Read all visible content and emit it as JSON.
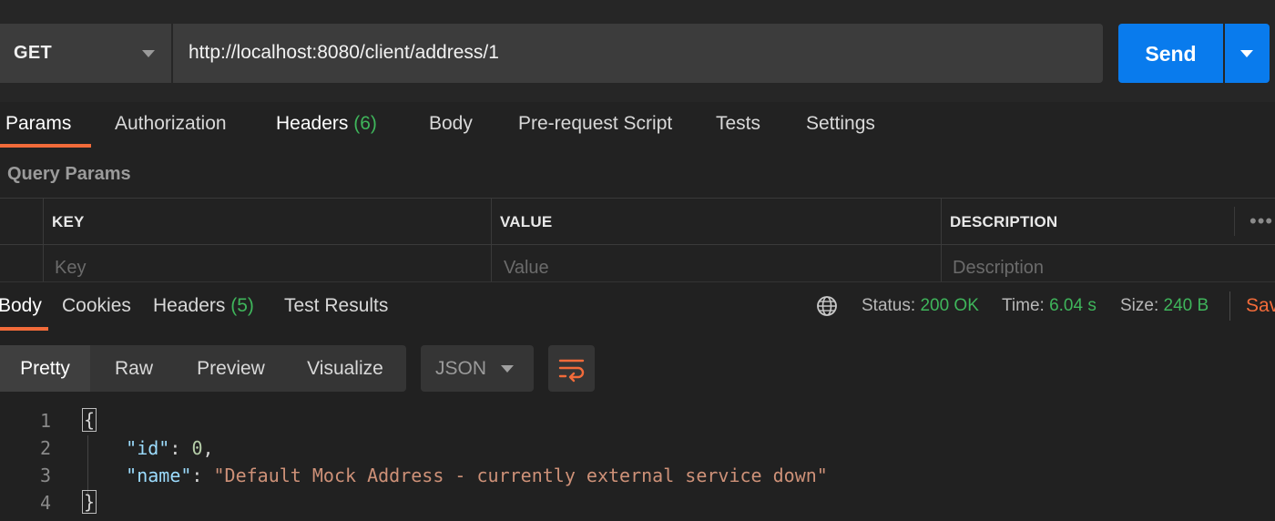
{
  "request": {
    "method": "GET",
    "url": "http://localhost:8080/client/address/1",
    "send_label": "Send"
  },
  "request_tabs": [
    {
      "label": "Params"
    },
    {
      "label": "Authorization"
    },
    {
      "label": "Headers",
      "count": "(6)"
    },
    {
      "label": "Body"
    },
    {
      "label": "Pre-request Script"
    },
    {
      "label": "Tests"
    },
    {
      "label": "Settings"
    }
  ],
  "query_params": {
    "title": "Query Params",
    "columns": [
      "KEY",
      "VALUE",
      "DESCRIPTION"
    ],
    "placeholders": [
      "Key",
      "Value",
      "Description"
    ],
    "more": "•••"
  },
  "response_tabs": [
    {
      "label": "Body"
    },
    {
      "label": "Cookies"
    },
    {
      "label": "Headers",
      "count": "(5)"
    },
    {
      "label": "Test Results"
    }
  ],
  "status": {
    "status_label": "Status:",
    "status_value": "200 OK",
    "time_label": "Time:",
    "time_value": "6.04 s",
    "size_label": "Size:",
    "size_value": "240 B",
    "save_label": "Sav"
  },
  "format": {
    "views": [
      "Pretty",
      "Raw",
      "Preview",
      "Visualize"
    ],
    "language": "JSON"
  },
  "code": {
    "line_numbers": [
      "1",
      "2",
      "3",
      "4"
    ],
    "open_brace": "{",
    "close_brace": "}",
    "id_key": "\"id\"",
    "id_value": "0",
    "name_key": "\"name\"",
    "name_value": "\"Default Mock Address - currently external service down\""
  },
  "colors": {
    "accent": "#f26b3a",
    "primary_button": "#097bed",
    "success": "#3fb55b",
    "background": "#222222"
  },
  "icons": {
    "method_dropdown": "chevron-down-icon",
    "send_dropdown": "chevron-down-icon",
    "network": "globe-icon",
    "wrap": "wrap-lines-icon",
    "more": "ellipsis-icon"
  }
}
